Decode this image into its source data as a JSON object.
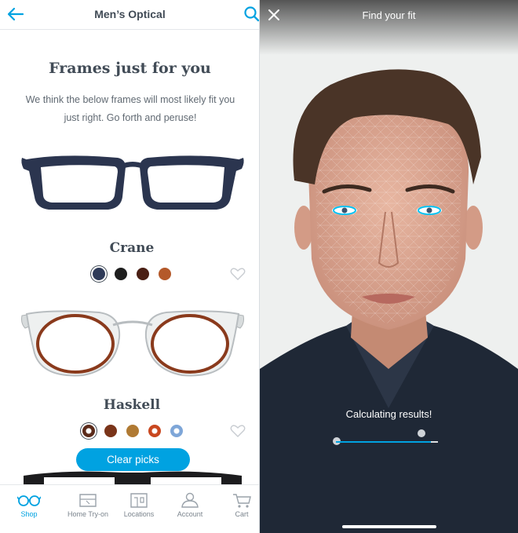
{
  "left": {
    "header": {
      "title": "Men’s Optical",
      "back_icon": "arrow-left-icon",
      "search_icon": "search-icon"
    },
    "intro": {
      "heading": "Frames just for you",
      "subtext": "We think the below frames will most likely fit you just right. Go forth and peruse!"
    },
    "frames": [
      {
        "name": "Crane",
        "swatches": [
          "#2e3a58",
          "#1e1e1e",
          "#4a1f14",
          "#b4592a"
        ],
        "selected": 0
      },
      {
        "name": "Haskell",
        "swatches": [
          "#5a2a1a",
          "#7a3419",
          "#b07a33",
          "#c9471f",
          "#7ea6d8"
        ],
        "selected": 0
      }
    ],
    "clear_label": "Clear picks",
    "tabs": [
      {
        "label": "Shop",
        "icon": "glasses-icon",
        "active": true
      },
      {
        "label": "Home Try-on",
        "icon": "home-try-on-box-icon",
        "active": false
      },
      {
        "label": "Locations",
        "icon": "store-icon",
        "active": false
      },
      {
        "label": "Account",
        "icon": "account-icon",
        "active": false
      },
      {
        "label": "Cart",
        "icon": "cart-icon",
        "active": false
      }
    ],
    "accent_color": "#00a2e1"
  },
  "right": {
    "title": "Find your fit",
    "close_icon": "close-icon",
    "status": "Calculating results!",
    "progress": 0.93
  }
}
